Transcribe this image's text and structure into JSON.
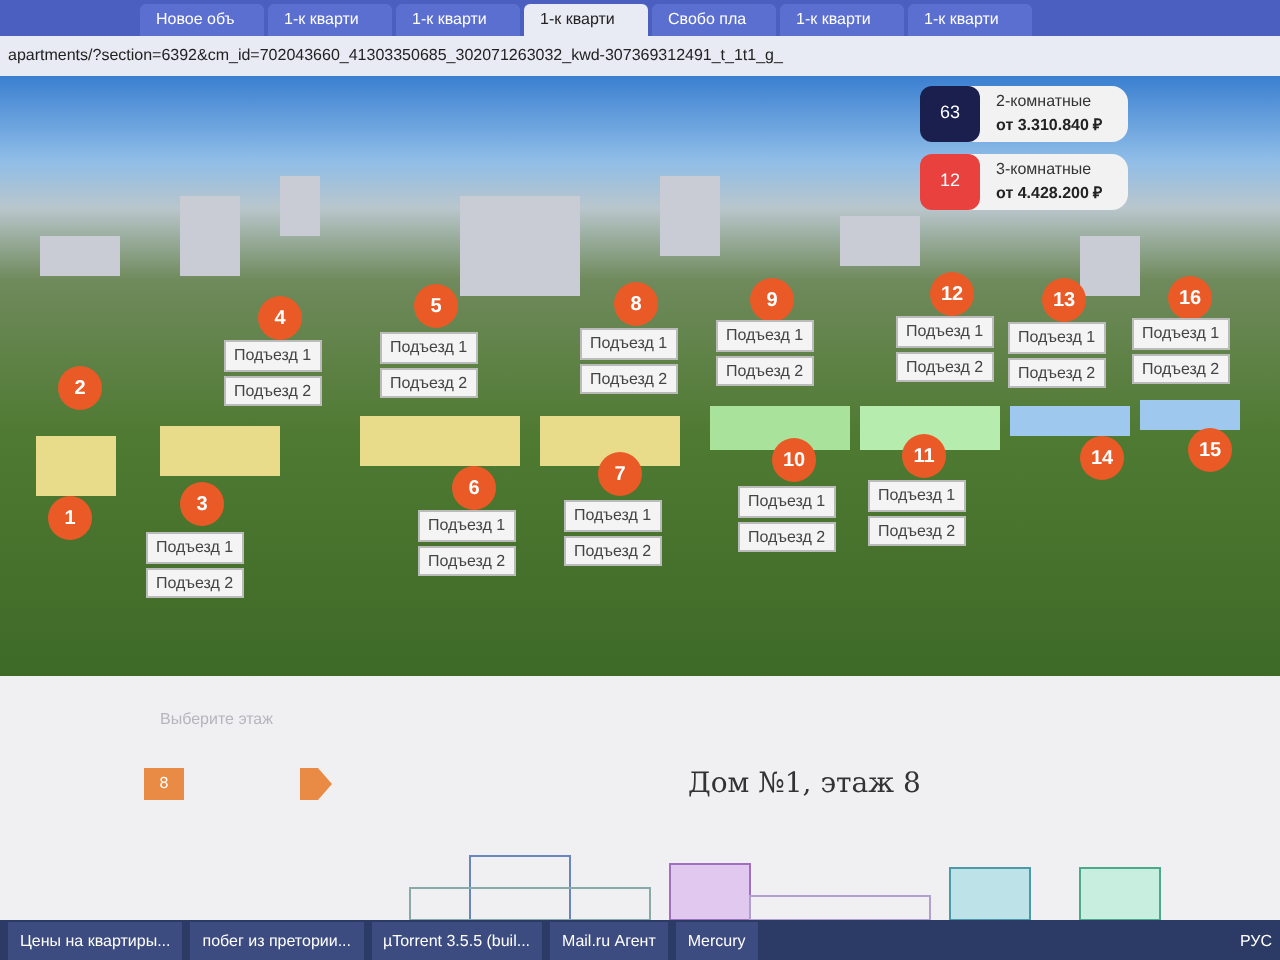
{
  "browser": {
    "tabs": [
      {
        "label": "Новое объ",
        "selected": false
      },
      {
        "label": "1-к кварти",
        "selected": false
      },
      {
        "label": "1-к кварти",
        "selected": false
      },
      {
        "label": "1-к кварти",
        "selected": true
      },
      {
        "label": "Свобо пла",
        "selected": false
      },
      {
        "label": "1-к кварти",
        "selected": false
      },
      {
        "label": "1-к кварти",
        "selected": false
      }
    ],
    "url": "apartments/?section=6392&cm_id=702043660_41303350685_302071263032_kwd-307369312491_t_1t1_g_"
  },
  "offers": [
    {
      "count": "63",
      "color": "#1a1f4d",
      "title": "2-комнатные",
      "price": "от 3.310.840 ₽"
    },
    {
      "count": "12",
      "color": "#e8413e",
      "title": "3-комнатные",
      "price": "от 4.428.200 ₽"
    }
  ],
  "houses": [
    {
      "number": "4",
      "entrances": [
        "Подъезд 1",
        "Подъезд 2"
      ]
    },
    {
      "number": "5",
      "entrances": [
        "Подъезд 1",
        "Подъезд 2"
      ]
    },
    {
      "number": "8",
      "entrances": [
        "Подъезд 1",
        "Подъезд 2"
      ]
    },
    {
      "number": "9",
      "entrances": [
        "Подъезд 1",
        "Подъезд 2"
      ]
    },
    {
      "number": "12",
      "entrances": [
        "Подъезд 1",
        "Подъезд 2"
      ]
    },
    {
      "number": "13",
      "entrances": [
        "Подъезд 1",
        "Подъезд 2"
      ]
    },
    {
      "number": "16",
      "entrances": [
        "Подъезд 1",
        "Подъезд 2"
      ]
    },
    {
      "number": "2"
    },
    {
      "number": "1"
    },
    {
      "number": "3",
      "entrances": [
        "Подъезд 1",
        "Подъезд 2"
      ]
    },
    {
      "number": "6",
      "entrances": [
        "Подъезд 1",
        "Подъезд 2"
      ]
    },
    {
      "number": "7",
      "entrances": [
        "Подъезд 1",
        "Подъезд 2"
      ]
    },
    {
      "number": "10",
      "entrances": [
        "Подъезд 1",
        "Подъезд 2"
      ]
    },
    {
      "number": "11",
      "entrances": [
        "Подъезд 1",
        "Подъезд 2"
      ]
    },
    {
      "number": "14"
    },
    {
      "number": "15"
    }
  ],
  "floor_picker": {
    "label": "Выберите этаж",
    "floor": "8",
    "heading": "Дом №1, этаж 8"
  },
  "taskbar": {
    "items": [
      "Цены на квартиры...",
      "побег из претории...",
      "µTorrent 3.5.5  (buil...",
      "Mail.ru Агент",
      "Mercury"
    ],
    "language": "РУС"
  }
}
